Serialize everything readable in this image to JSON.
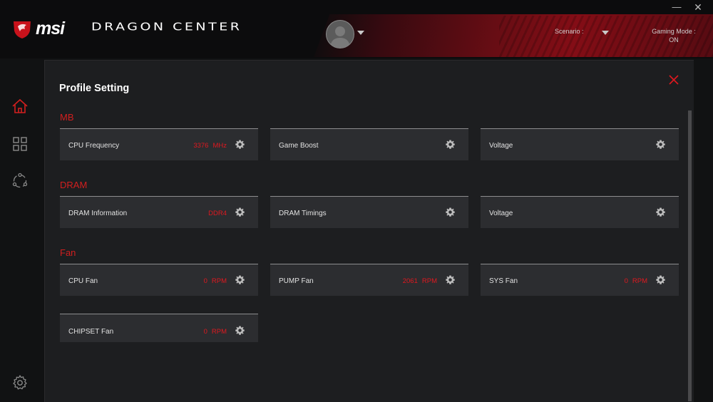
{
  "app": {
    "brand": "msi",
    "title": "DRAGON CENTER"
  },
  "header": {
    "scenario_label": "Scenario :",
    "gaming_mode_label": "Gaming Mode :",
    "gaming_mode_value": "ON"
  },
  "window": {
    "minimize": "—",
    "close": "✕"
  },
  "sidebar": {
    "items": [
      "home-icon",
      "grid-icon",
      "share-network-icon",
      "gear-icon"
    ]
  },
  "panel": {
    "title": "Profile Setting",
    "sections": [
      {
        "label": "MB",
        "cards": [
          {
            "label": "CPU Frequency",
            "value": "3376",
            "unit": "MHz"
          },
          {
            "label": "Game Boost",
            "value": "",
            "unit": ""
          },
          {
            "label": "Voltage",
            "value": "",
            "unit": ""
          }
        ]
      },
      {
        "label": "DRAM",
        "cards": [
          {
            "label": "DRAM Information",
            "value": "DDR4",
            "unit": ""
          },
          {
            "label": "DRAM Timings",
            "value": "",
            "unit": ""
          },
          {
            "label": "Voltage",
            "value": "",
            "unit": ""
          }
        ]
      },
      {
        "label": "Fan",
        "cards": [
          {
            "label": "CPU Fan",
            "value": "0",
            "unit": "RPM"
          },
          {
            "label": "PUMP Fan",
            "value": "2061",
            "unit": "RPM"
          },
          {
            "label": "SYS Fan",
            "value": "0",
            "unit": "RPM"
          },
          {
            "label": "CHIPSET Fan",
            "value": "0",
            "unit": "RPM"
          }
        ]
      }
    ]
  },
  "colors": {
    "accent": "#d21f1f",
    "value": "#e0181f",
    "card": "#2c2d30",
    "panel": "#1d1e20"
  }
}
